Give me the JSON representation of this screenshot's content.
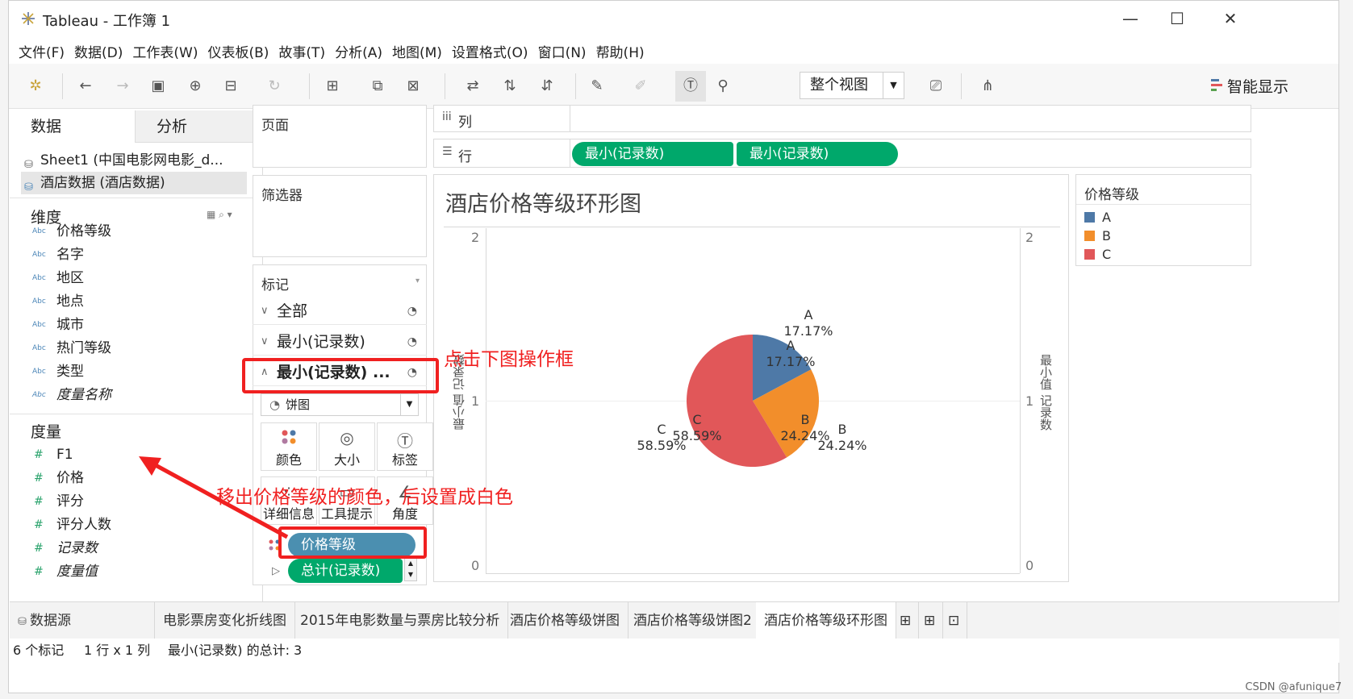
{
  "window": {
    "title": "Tableau - 工作簿 1",
    "controls": {
      "minimize": "—",
      "maximize": "☐",
      "close": "✕"
    }
  },
  "menu": [
    "文件(F)",
    "数据(D)",
    "工作表(W)",
    "仪表板(B)",
    "故事(T)",
    "分析(A)",
    "地图(M)",
    "设置格式(O)",
    "窗口(N)",
    "帮助(H)"
  ],
  "toolbar": {
    "fit_view": "整个视图",
    "show_me": "智能显示"
  },
  "data_pane": {
    "tabs": {
      "data": "数据",
      "analysis": "分析"
    },
    "sources": [
      "Sheet1 (中国电影网电影_d...",
      "酒店数据 (酒店数据)"
    ],
    "dimensions_header": "维度",
    "dimensions": [
      "价格等级",
      "名字",
      "地区",
      "地点",
      "城市",
      "热门等级",
      "类型",
      "度量名称"
    ],
    "measures_header": "度量",
    "measures": [
      "F1",
      "价格",
      "评分",
      "评分人数",
      "记录数",
      "度量值"
    ],
    "abc": "Abc",
    "hash": "#"
  },
  "shelves": {
    "pages": "页面",
    "filters": "筛选器",
    "marks": "标记",
    "columns": "列",
    "rows": "行",
    "row_pills": [
      "最小(记录数)",
      "最小(记录数)"
    ]
  },
  "marks_card": {
    "all": "全部",
    "mark1": "最小(记录数)",
    "mark2": "最小(记录数) ...",
    "mark_type": "饼图",
    "buttons": [
      "颜色",
      "大小",
      "标签",
      "详细信息",
      "工具提示",
      "角度"
    ],
    "pill_color": "价格等级",
    "pill_angle": "总计(记录数)"
  },
  "annotations": {
    "click_box": "点击下图操作框",
    "remove_color": "移出价格等级的颜色，后设置成白色"
  },
  "view": {
    "title": "酒店价格等级环形图",
    "axis_label": "最小值 记录数",
    "axis_right_label": "记录数",
    "ticks": [
      "2",
      "1",
      "0"
    ]
  },
  "legend": {
    "title": "价格等级",
    "items": [
      {
        "label": "A",
        "color": "#4e79a7"
      },
      {
        "label": "B",
        "color": "#f28e2b"
      },
      {
        "label": "C",
        "color": "#e15759"
      }
    ]
  },
  "chart_data": {
    "type": "pie",
    "title": "酒店价格等级环形图",
    "categories": [
      "A",
      "B",
      "C"
    ],
    "values": [
      17.17,
      24.24,
      58.59
    ],
    "labels": [
      "17.17%",
      "24.24%",
      "58.59%"
    ],
    "colors": [
      "#4e79a7",
      "#f28e2b",
      "#e15759"
    ],
    "ylabel": "最小值 记录数",
    "ylim": [
      0,
      2
    ]
  },
  "sheet_tabs": [
    "数据源",
    "电影票房变化折线图",
    "2015年电影数量与票房比较分析",
    "酒店价格等级饼图",
    "酒店价格等级饼图2",
    "酒店价格等级环形图"
  ],
  "status": {
    "marks": "6 个标记",
    "rows_cols": "1 行 x 1 列",
    "sum": "最小(记录数) 的总计: 3"
  },
  "watermark": "CSDN @afunique7"
}
